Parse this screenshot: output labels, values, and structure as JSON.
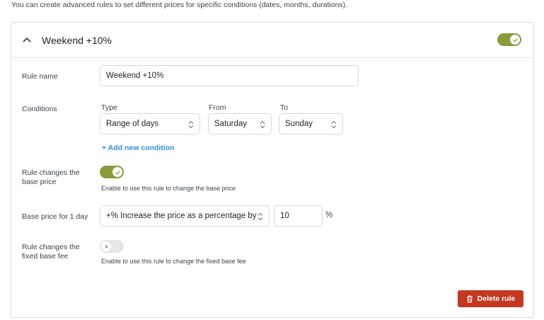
{
  "intro_text": "You can create advanced rules to set different prices for specific conditions (dates, months, durations).",
  "rule": {
    "title": "Weekend +10%",
    "enabled": true,
    "name_label": "Rule name",
    "name_value": "Weekend +10%",
    "conditions_label": "Conditions",
    "conditions": {
      "type_label": "Type",
      "type_value": "Range of days",
      "from_label": "From",
      "from_value": "Saturday",
      "to_label": "To",
      "to_value": "Sunday"
    },
    "add_condition_label": "+ Add new condition",
    "base_price_toggle": {
      "label_line1": "Rule changes the",
      "label_line2": "base price",
      "enabled": true,
      "help": "Enable to use this rule to change the base price"
    },
    "base_price": {
      "label": "Base price for 1 day",
      "mode_value": "+% Increase the price as a percentage by",
      "amount_value": "10",
      "unit": "%"
    },
    "fixed_fee_toggle": {
      "label_line1": "Rule changes the",
      "label_line2": "fixed base fee",
      "enabled": false,
      "help": "Enable to use this rule to change the fixed base fee"
    },
    "delete_label": "Delete rule"
  },
  "colors": {
    "toggle_on": "#8a9a3c",
    "link": "#2f8ed8",
    "delete": "#c3381f"
  },
  "icons": {
    "collapse": "chevron-up-icon",
    "toggle_on": "check-icon",
    "toggle_off": "x-icon",
    "select": "up-down-chevron-icon",
    "delete": "trash-icon"
  }
}
